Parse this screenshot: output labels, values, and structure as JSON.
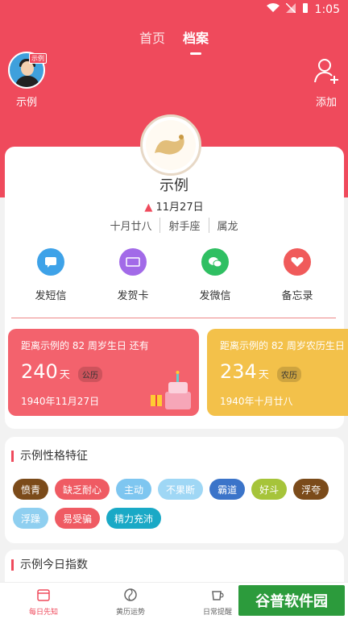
{
  "status_bar": {
    "time": "1:05"
  },
  "tabs": [
    {
      "label": "首页"
    },
    {
      "label": "档案"
    }
  ],
  "profile_top": {
    "avatar_badge": "示例",
    "name": "示例",
    "add_label": "添加"
  },
  "profile": {
    "name": "示例",
    "birthday": "11月27日",
    "lunar": "十月廿八",
    "zodiac_sign": "射手座",
    "zodiac_animal": "属龙"
  },
  "actions": [
    {
      "label": "发短信",
      "color": "#3ea2e8"
    },
    {
      "label": "发贺卡",
      "color": "#a26ae8"
    },
    {
      "label": "发微信",
      "color": "#2fbf62"
    },
    {
      "label": "备忘录",
      "color": "#f05a5a"
    }
  ],
  "birthday_cards": [
    {
      "line": "距离示例的 82 周岁生日 还有",
      "days": "240",
      "unit": "天",
      "tag": "公历",
      "date": "1940年11月27日",
      "color": "#f3626d"
    },
    {
      "line": "距离示例的 82 周岁农历生日",
      "days": "234",
      "unit": "天",
      "tag": "农历",
      "date": "1940年十月廿八",
      "color": "#f3c14a"
    }
  ],
  "traits_section": {
    "title": "示例性格特征",
    "chips": [
      {
        "label": "愤青",
        "color": "#7b4b1a"
      },
      {
        "label": "缺乏耐心",
        "color": "#ef5b63"
      },
      {
        "label": "主动",
        "color": "#7ec6f0"
      },
      {
        "label": "不果断",
        "color": "#9fd7f5"
      },
      {
        "label": "霸道",
        "color": "#3b74c9"
      },
      {
        "label": "好斗",
        "color": "#a6c43a"
      },
      {
        "label": "浮夸",
        "color": "#7b4b1a"
      },
      {
        "label": "浮躁",
        "color": "#8fcff0"
      },
      {
        "label": "易受骗",
        "color": "#ef5b63"
      },
      {
        "label": "精力充沛",
        "color": "#1aa9c6"
      }
    ]
  },
  "index_section": {
    "title": "示例今日指数"
  },
  "bottom_nav": [
    {
      "label": "每日先知",
      "icon_text": "01"
    },
    {
      "label": "黄历运势"
    },
    {
      "label": "日常提醒"
    }
  ],
  "watermark": "谷普软件园"
}
